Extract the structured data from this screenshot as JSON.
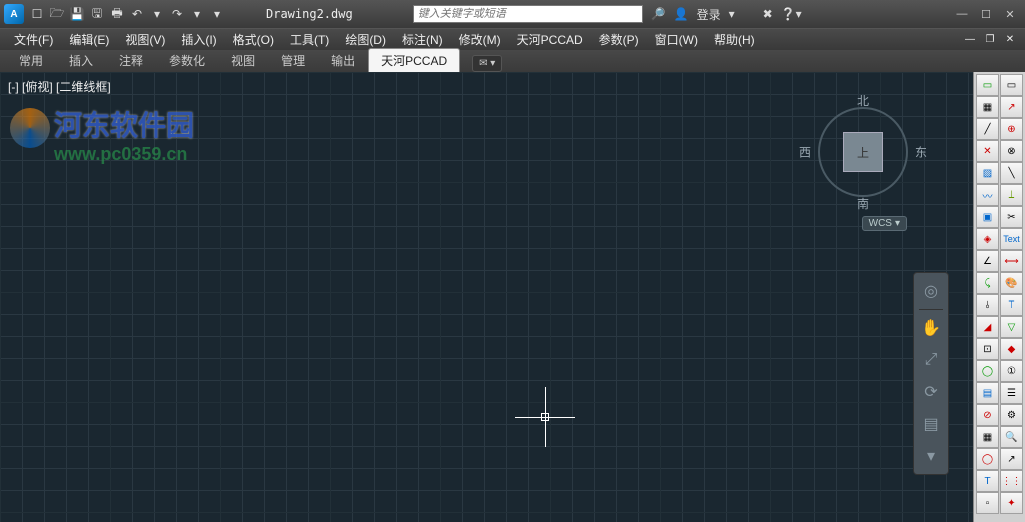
{
  "title": "Drawing2.dwg",
  "search_placeholder": "键入关键字或短语",
  "login_label": "登录",
  "menubar": [
    "文件(F)",
    "编辑(E)",
    "视图(V)",
    "插入(I)",
    "格式(O)",
    "工具(T)",
    "绘图(D)",
    "标注(N)",
    "修改(M)",
    "天河PCCAD",
    "参数(P)",
    "窗口(W)",
    "帮助(H)"
  ],
  "tabs": [
    "常用",
    "插入",
    "注释",
    "参数化",
    "视图",
    "管理",
    "输出",
    "天河PCCAD"
  ],
  "active_tab": 7,
  "view_label": "[-] [俯视] [二维线框]",
  "viewcube": {
    "north": "北",
    "south": "南",
    "east": "东",
    "west": "西",
    "face": "上",
    "wcs": "WCS"
  },
  "watermark": {
    "main": "河东软件园",
    "sub": "www.pc0359.cn"
  }
}
